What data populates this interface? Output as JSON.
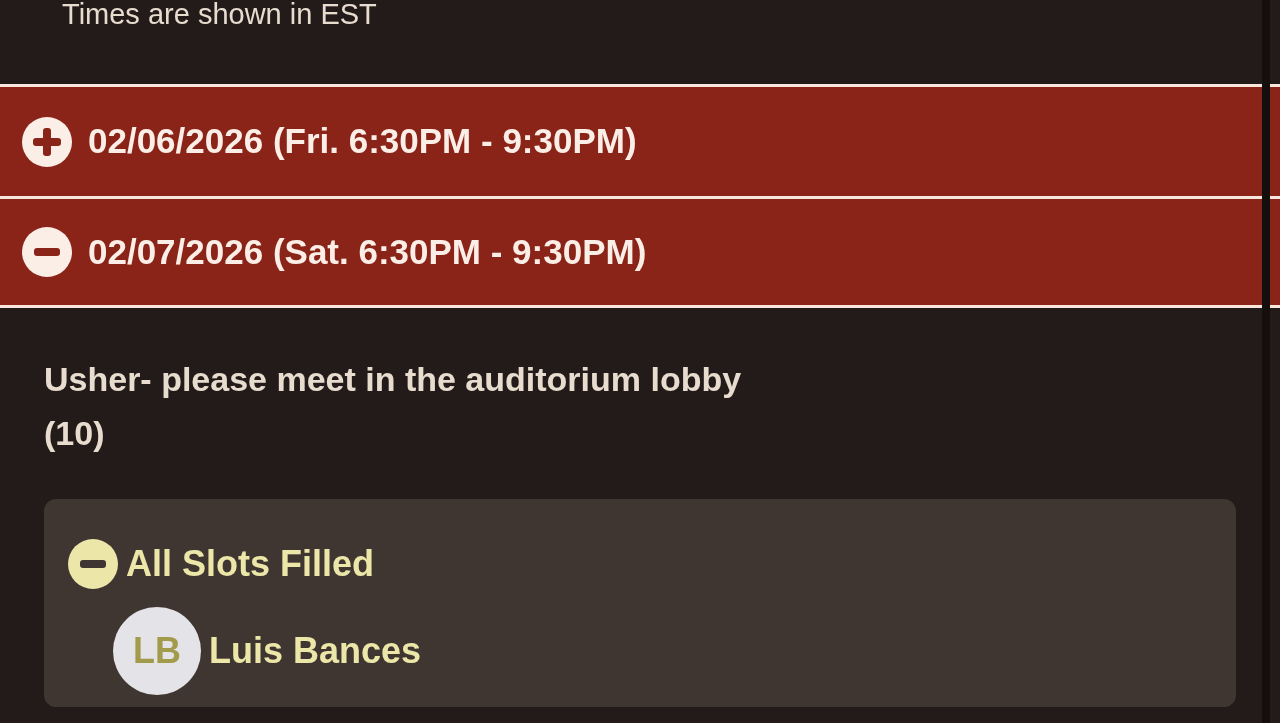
{
  "timezone_note": "Times are shown in EST",
  "dates": [
    {
      "label": "02/06/2026 (Fri. 6:30PM - 9:30PM)",
      "expanded": false
    },
    {
      "label": "02/07/2026 (Sat. 6:30PM - 9:30PM)",
      "expanded": true
    }
  ],
  "role": {
    "title": "Usher- please meet in the auditorium lobby",
    "count": "(10)"
  },
  "slots": {
    "label": "All Slots Filled",
    "expanded": true,
    "signups": [
      {
        "initials": "LB",
        "name": "Luis Bances"
      }
    ]
  }
}
